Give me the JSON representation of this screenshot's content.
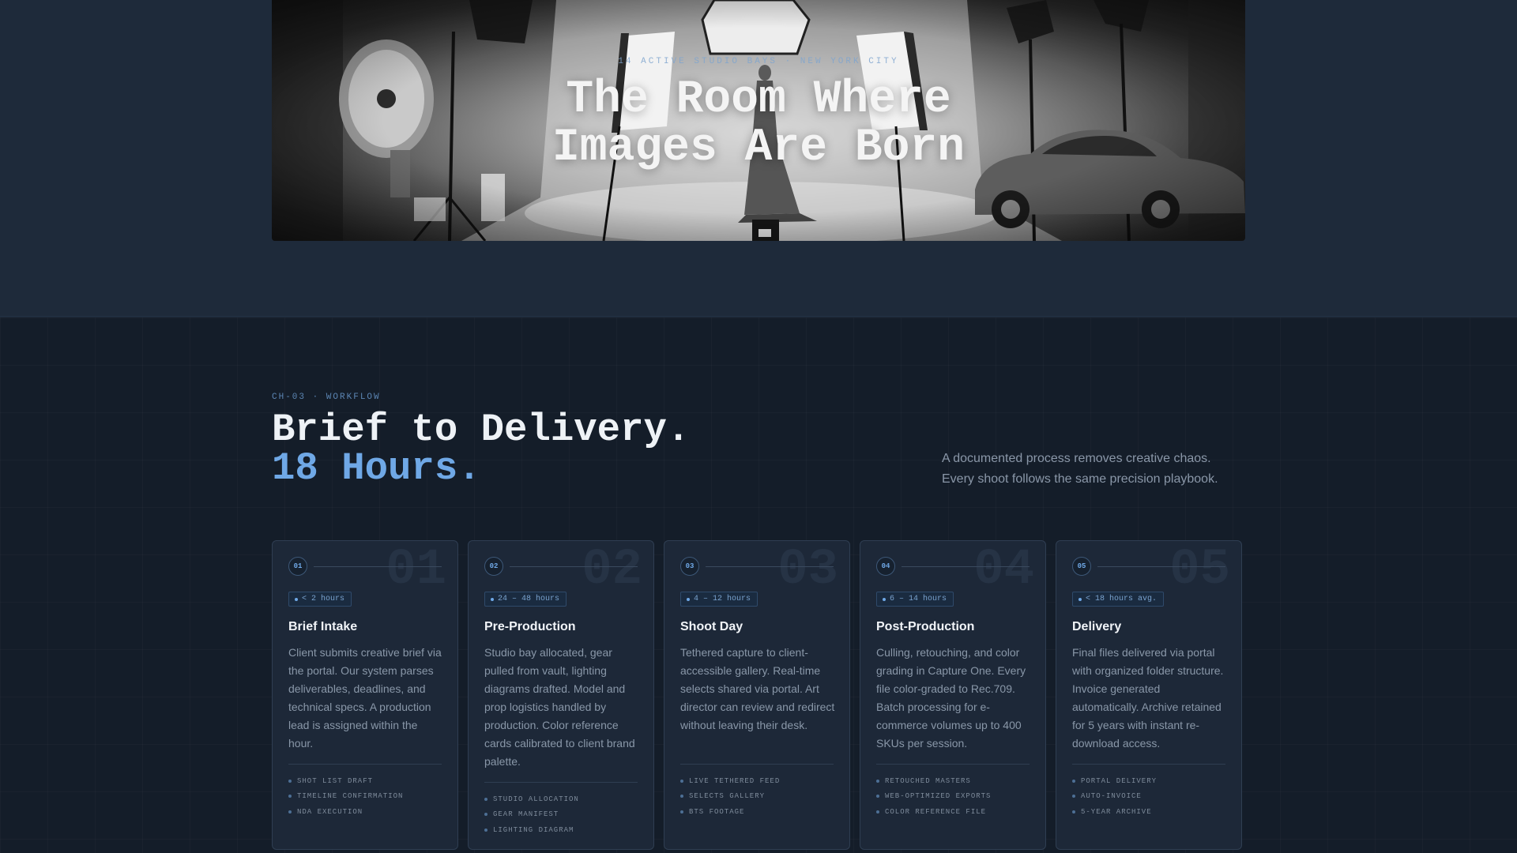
{
  "hero": {
    "kicker": "14 ACTIVE STUDIO BAYS · NEW YORK CITY",
    "title_line1": "The Room Where",
    "title_line2": "Images Are Born"
  },
  "workflow": {
    "kicker": "CH-03 · WORKFLOW",
    "headline_line1": "Brief to Delivery.",
    "headline_line2": "18 Hours.",
    "intro": "A documented process removes creative chaos. Every shoot follows the same precision playbook.",
    "steps": [
      {
        "num": "01",
        "big_num": "01",
        "badge": "< 2 hours",
        "title": "Brief Intake",
        "desc": "Client submits creative brief via the portal. Our system parses deliverables, deadlines, and technical specs. A production lead is assigned within the hour.",
        "items": [
          "SHOT LIST DRAFT",
          "TIMELINE CONFIRMATION",
          "NDA EXECUTION"
        ]
      },
      {
        "num": "02",
        "big_num": "02",
        "badge": "24 – 48 hours",
        "title": "Pre-Production",
        "desc": "Studio bay allocated, gear pulled from vault, lighting diagrams drafted. Model and prop logistics handled by production. Color reference cards calibrated to client brand palette.",
        "items": [
          "STUDIO ALLOCATION",
          "GEAR MANIFEST",
          "LIGHTING DIAGRAM"
        ]
      },
      {
        "num": "03",
        "big_num": "03",
        "badge": "4 – 12 hours",
        "title": "Shoot Day",
        "desc": "Tethered capture to client-accessible gallery. Real-time selects shared via portal. Art director can review and redirect without leaving their desk.",
        "items": [
          "LIVE TETHERED FEED",
          "SELECTS GALLERY",
          "BTS FOOTAGE"
        ]
      },
      {
        "num": "04",
        "big_num": "04",
        "badge": "6 – 14 hours",
        "title": "Post-Production",
        "desc": "Culling, retouching, and color grading in Capture One. Every file color-graded to Rec.709. Batch processing for e-commerce volumes up to 400 SKUs per session.",
        "items": [
          "RETOUCHED MASTERS",
          "WEB-OPTIMIZED EXPORTS",
          "COLOR REFERENCE FILE"
        ]
      },
      {
        "num": "05",
        "big_num": "05",
        "badge": "< 18 hours avg.",
        "title": "Delivery",
        "desc": "Final files delivered via portal with organized folder structure. Invoice generated automatically. Archive retained for 5 years with instant re-download access.",
        "items": [
          "PORTAL DELIVERY",
          "AUTO-INVOICE",
          "5-YEAR ARCHIVE"
        ]
      }
    ]
  }
}
